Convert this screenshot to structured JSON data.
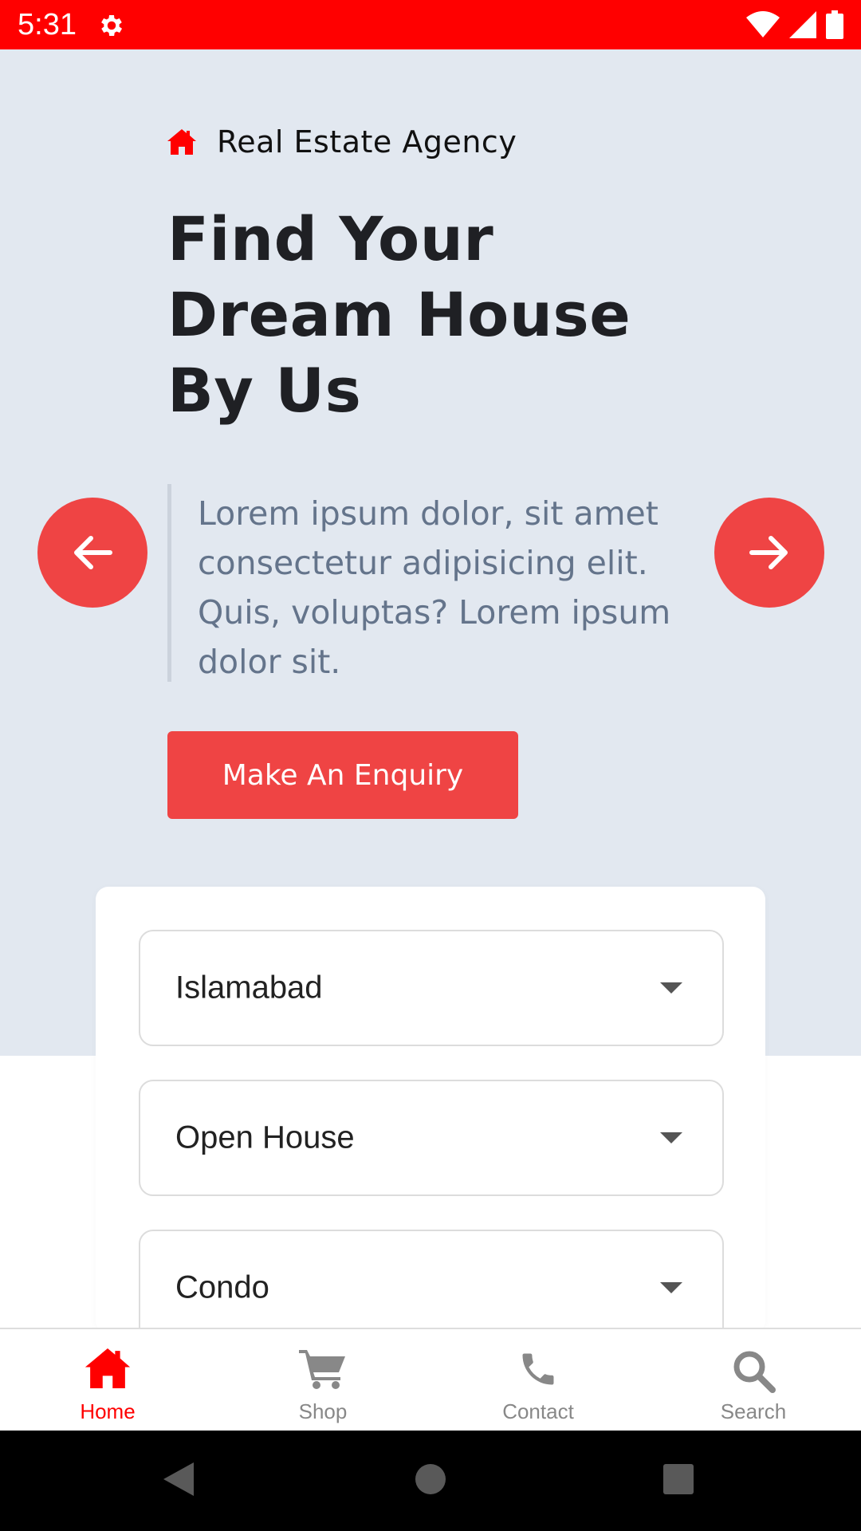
{
  "status_bar": {
    "time": "5:31",
    "background": "#ff0000",
    "icons": [
      "gear-icon",
      "wifi-icon",
      "signal-icon",
      "battery-icon"
    ]
  },
  "hero": {
    "brand": {
      "icon": "home-icon",
      "text": "Real Estate Agency"
    },
    "headline_lines": [
      "Find Your",
      "Dream House",
      "By Us"
    ],
    "description": "Lorem ipsum dolor, sit amet consectetur adipisicing elit. Quis, voluptas? Lorem ipsum dolor sit.",
    "prev_icon": "arrow-left-icon",
    "next_icon": "arrow-right-icon",
    "enquiry_label": "Make An Enquiry",
    "accent": "#ef4444",
    "background": "#e2e8f0"
  },
  "search_card": {
    "selects": [
      {
        "value": "Islamabad"
      },
      {
        "value": "Open House"
      },
      {
        "value": "Condo"
      }
    ]
  },
  "bottom_nav": {
    "items": [
      {
        "label": "Home",
        "icon": "home-icon",
        "active": true
      },
      {
        "label": "Shop",
        "icon": "cart-icon",
        "active": false
      },
      {
        "label": "Contact",
        "icon": "phone-icon",
        "active": false
      },
      {
        "label": "Search",
        "icon": "search-icon",
        "active": false
      }
    ],
    "active_color": "#ff0000",
    "inactive_color": "#888888"
  },
  "system_nav": {
    "buttons": [
      "back-icon",
      "home-circle-icon",
      "recents-icon"
    ]
  }
}
